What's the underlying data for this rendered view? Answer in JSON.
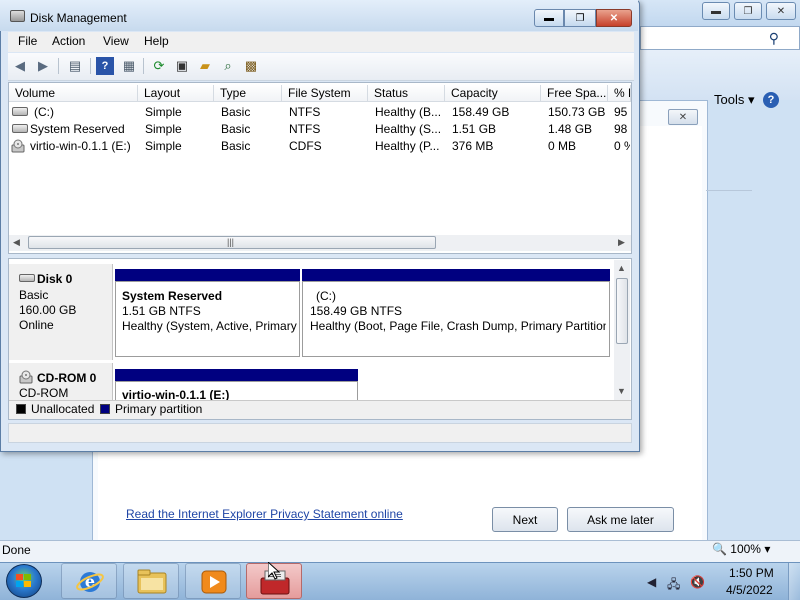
{
  "disk_management": {
    "title": "Disk Management",
    "menu": [
      "File",
      "Action",
      "View",
      "Help"
    ],
    "columns": [
      "Volume",
      "Layout",
      "Type",
      "File System",
      "Status",
      "Capacity",
      "Free Spa...",
      "% F"
    ],
    "volumes": [
      {
        "volume": "(C:)",
        "layout": "Simple",
        "type": "Basic",
        "fs": "NTFS",
        "status": "Healthy (B...",
        "capacity": "158.49 GB",
        "free": "150.73 GB",
        "pct": "95"
      },
      {
        "volume": "System Reserved",
        "layout": "Simple",
        "type": "Basic",
        "fs": "NTFS",
        "status": "Healthy (S...",
        "capacity": "1.51 GB",
        "free": "1.48 GB",
        "pct": "98"
      },
      {
        "volume": "virtio-win-0.1.1 (E:)",
        "layout": "Simple",
        "type": "Basic",
        "fs": "CDFS",
        "status": "Healthy (P...",
        "capacity": "376 MB",
        "free": "0 MB",
        "pct": "0 %"
      }
    ],
    "disks": [
      {
        "name": "Disk 0",
        "kind": "Basic",
        "size": "160.00 GB",
        "state": "Online",
        "partitions": [
          {
            "name": "System Reserved",
            "size": "1.51 GB NTFS",
            "status": "Healthy (System, Active, Primary"
          },
          {
            "name": "(C:)",
            "size": "158.49 GB NTFS",
            "status": "Healthy (Boot, Page File, Crash Dump, Primary Partition"
          }
        ]
      },
      {
        "name": "CD-ROM 0",
        "kind": "CD-ROM",
        "partitions": [
          {
            "name": "virtio-win-0.1.1  (E:)"
          }
        ]
      }
    ],
    "legend": [
      {
        "label": "Unallocated",
        "color": "#000000"
      },
      {
        "label": "Primary partition",
        "color": "#000080"
      }
    ]
  },
  "ie": {
    "tools_label": "Tools",
    "privacy_link": "Read the Internet Explorer Privacy Statement online",
    "next_button": "Next",
    "ask_later_button": "Ask me later",
    "status_text": "Done",
    "zoom": "100%"
  },
  "taskbar": {
    "time": "1:50 PM",
    "date": "4/5/2022",
    "apps": [
      "internet-explorer",
      "windows-explorer",
      "media-player",
      "disk-management"
    ]
  }
}
